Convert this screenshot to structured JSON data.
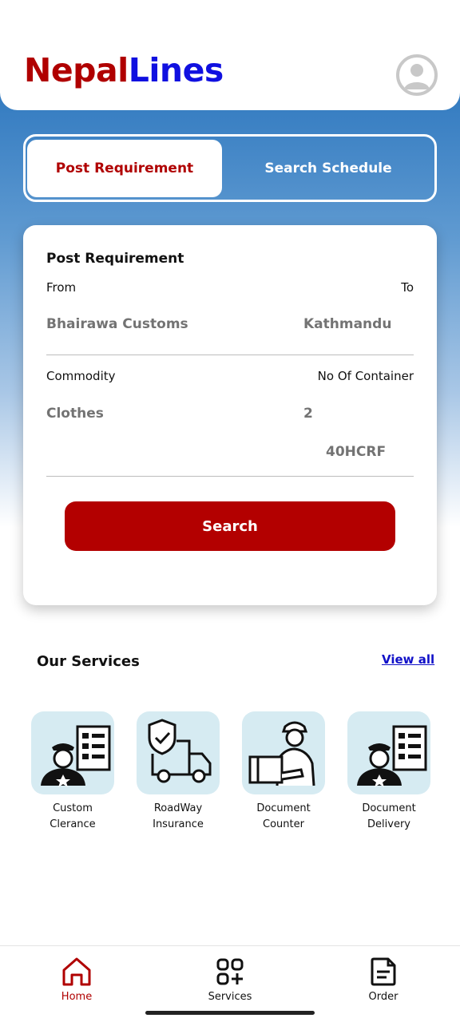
{
  "header": {
    "logo_part1": "Nepal",
    "logo_part2": "Lines",
    "logo_colors": {
      "nepal": "#b00000",
      "lines": "#1010e0"
    },
    "avatar_icon": "user-avatar-icon"
  },
  "tabs": [
    {
      "label": "Post Requirement",
      "active": true
    },
    {
      "label": "Search Schedule",
      "active": false
    }
  ],
  "form": {
    "title": "Post Requirement",
    "from_label": "From",
    "to_label": "To",
    "from_value": "Bhairawa Customs",
    "to_value": "Kathmandu",
    "commodity_label": "Commodity",
    "containers_label": "No Of Container",
    "commodity_value": "Clothes",
    "container_count": "2",
    "container_type": "40HCRF",
    "search_label": "Search"
  },
  "services": {
    "title": "Our Services",
    "view_all": "View all",
    "items": [
      {
        "label": "Custom\nClerance",
        "icon": "customs-officer-icon"
      },
      {
        "label": "RoadWay\nInsurance",
        "icon": "insured-truck-icon"
      },
      {
        "label": "Document\nCounter",
        "icon": "delivery-person-icon"
      },
      {
        "label": "Document\nDelivery",
        "icon": "customs-officer-icon"
      }
    ]
  },
  "bottom_nav": [
    {
      "label": "Home",
      "icon": "home-icon",
      "active": true
    },
    {
      "label": "Services",
      "icon": "grid-plus-icon",
      "active": false
    },
    {
      "label": "Order",
      "icon": "document-icon",
      "active": false
    }
  ],
  "colors": {
    "brand_red": "#b30000",
    "tile_bg": "#d6ebf2",
    "gradient_top": "#2f78bf"
  }
}
